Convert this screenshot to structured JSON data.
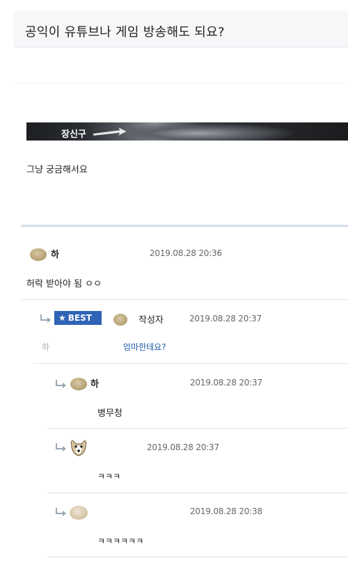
{
  "post": {
    "title": "공익이 유튜브나 게임 방송해도 되요?",
    "banner_name": "장신구",
    "body": "그냥 궁금해서요"
  },
  "comments": [
    {
      "nick": "하",
      "date": "2019.08.28 20:36",
      "text": "허락 받아야 됨 ㅇㅇ",
      "avatar": "potato-avatar-icon"
    },
    {
      "badge": "BEST",
      "nick": "작성자",
      "date": "2019.08.28 20:37",
      "quoted": "하",
      "text": "엄마한테요?",
      "avatar": "potato-avatar-icon"
    },
    {
      "nick": "하",
      "date": "2019.08.28 20:37",
      "text": "병무청",
      "avatar": "potato-avatar-icon"
    },
    {
      "nick": "",
      "date": "2019.08.28 20:37",
      "text": "ㅋㅋㅋ",
      "avatar": "dog-avatar-icon"
    },
    {
      "nick": "",
      "date": "2019.08.28 20:38",
      "text": "ㅋㅋㅋㅋㅋㅋ",
      "avatar": "puppy-avatar-icon"
    }
  ],
  "colors": {
    "best_badge": "#2f63b5",
    "link": "#1f5fa8"
  }
}
